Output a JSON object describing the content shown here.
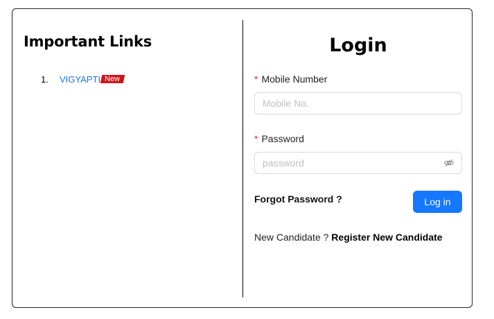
{
  "important_links": {
    "title": "Important Links",
    "items": [
      {
        "number": "1.",
        "label": "VIGYAPTI",
        "badge": "New"
      }
    ]
  },
  "login": {
    "title": "Login",
    "mobile": {
      "required_mark": "*",
      "label": "Mobile Number",
      "placeholder": "Mobile No.",
      "value": ""
    },
    "password": {
      "required_mark": "*",
      "label": "Password",
      "placeholder": "password",
      "value": "",
      "toggle_icon": "eye-slash-icon"
    },
    "forgot_label": "Forgot Password ?",
    "submit_label": "Log in",
    "register_prompt": "New Candidate ?",
    "register_link": "Register New Candidate"
  },
  "colors": {
    "primary_button": "#1677ff",
    "link": "#1a73e8",
    "badge": "#d0131a",
    "required": "#e0282e"
  }
}
